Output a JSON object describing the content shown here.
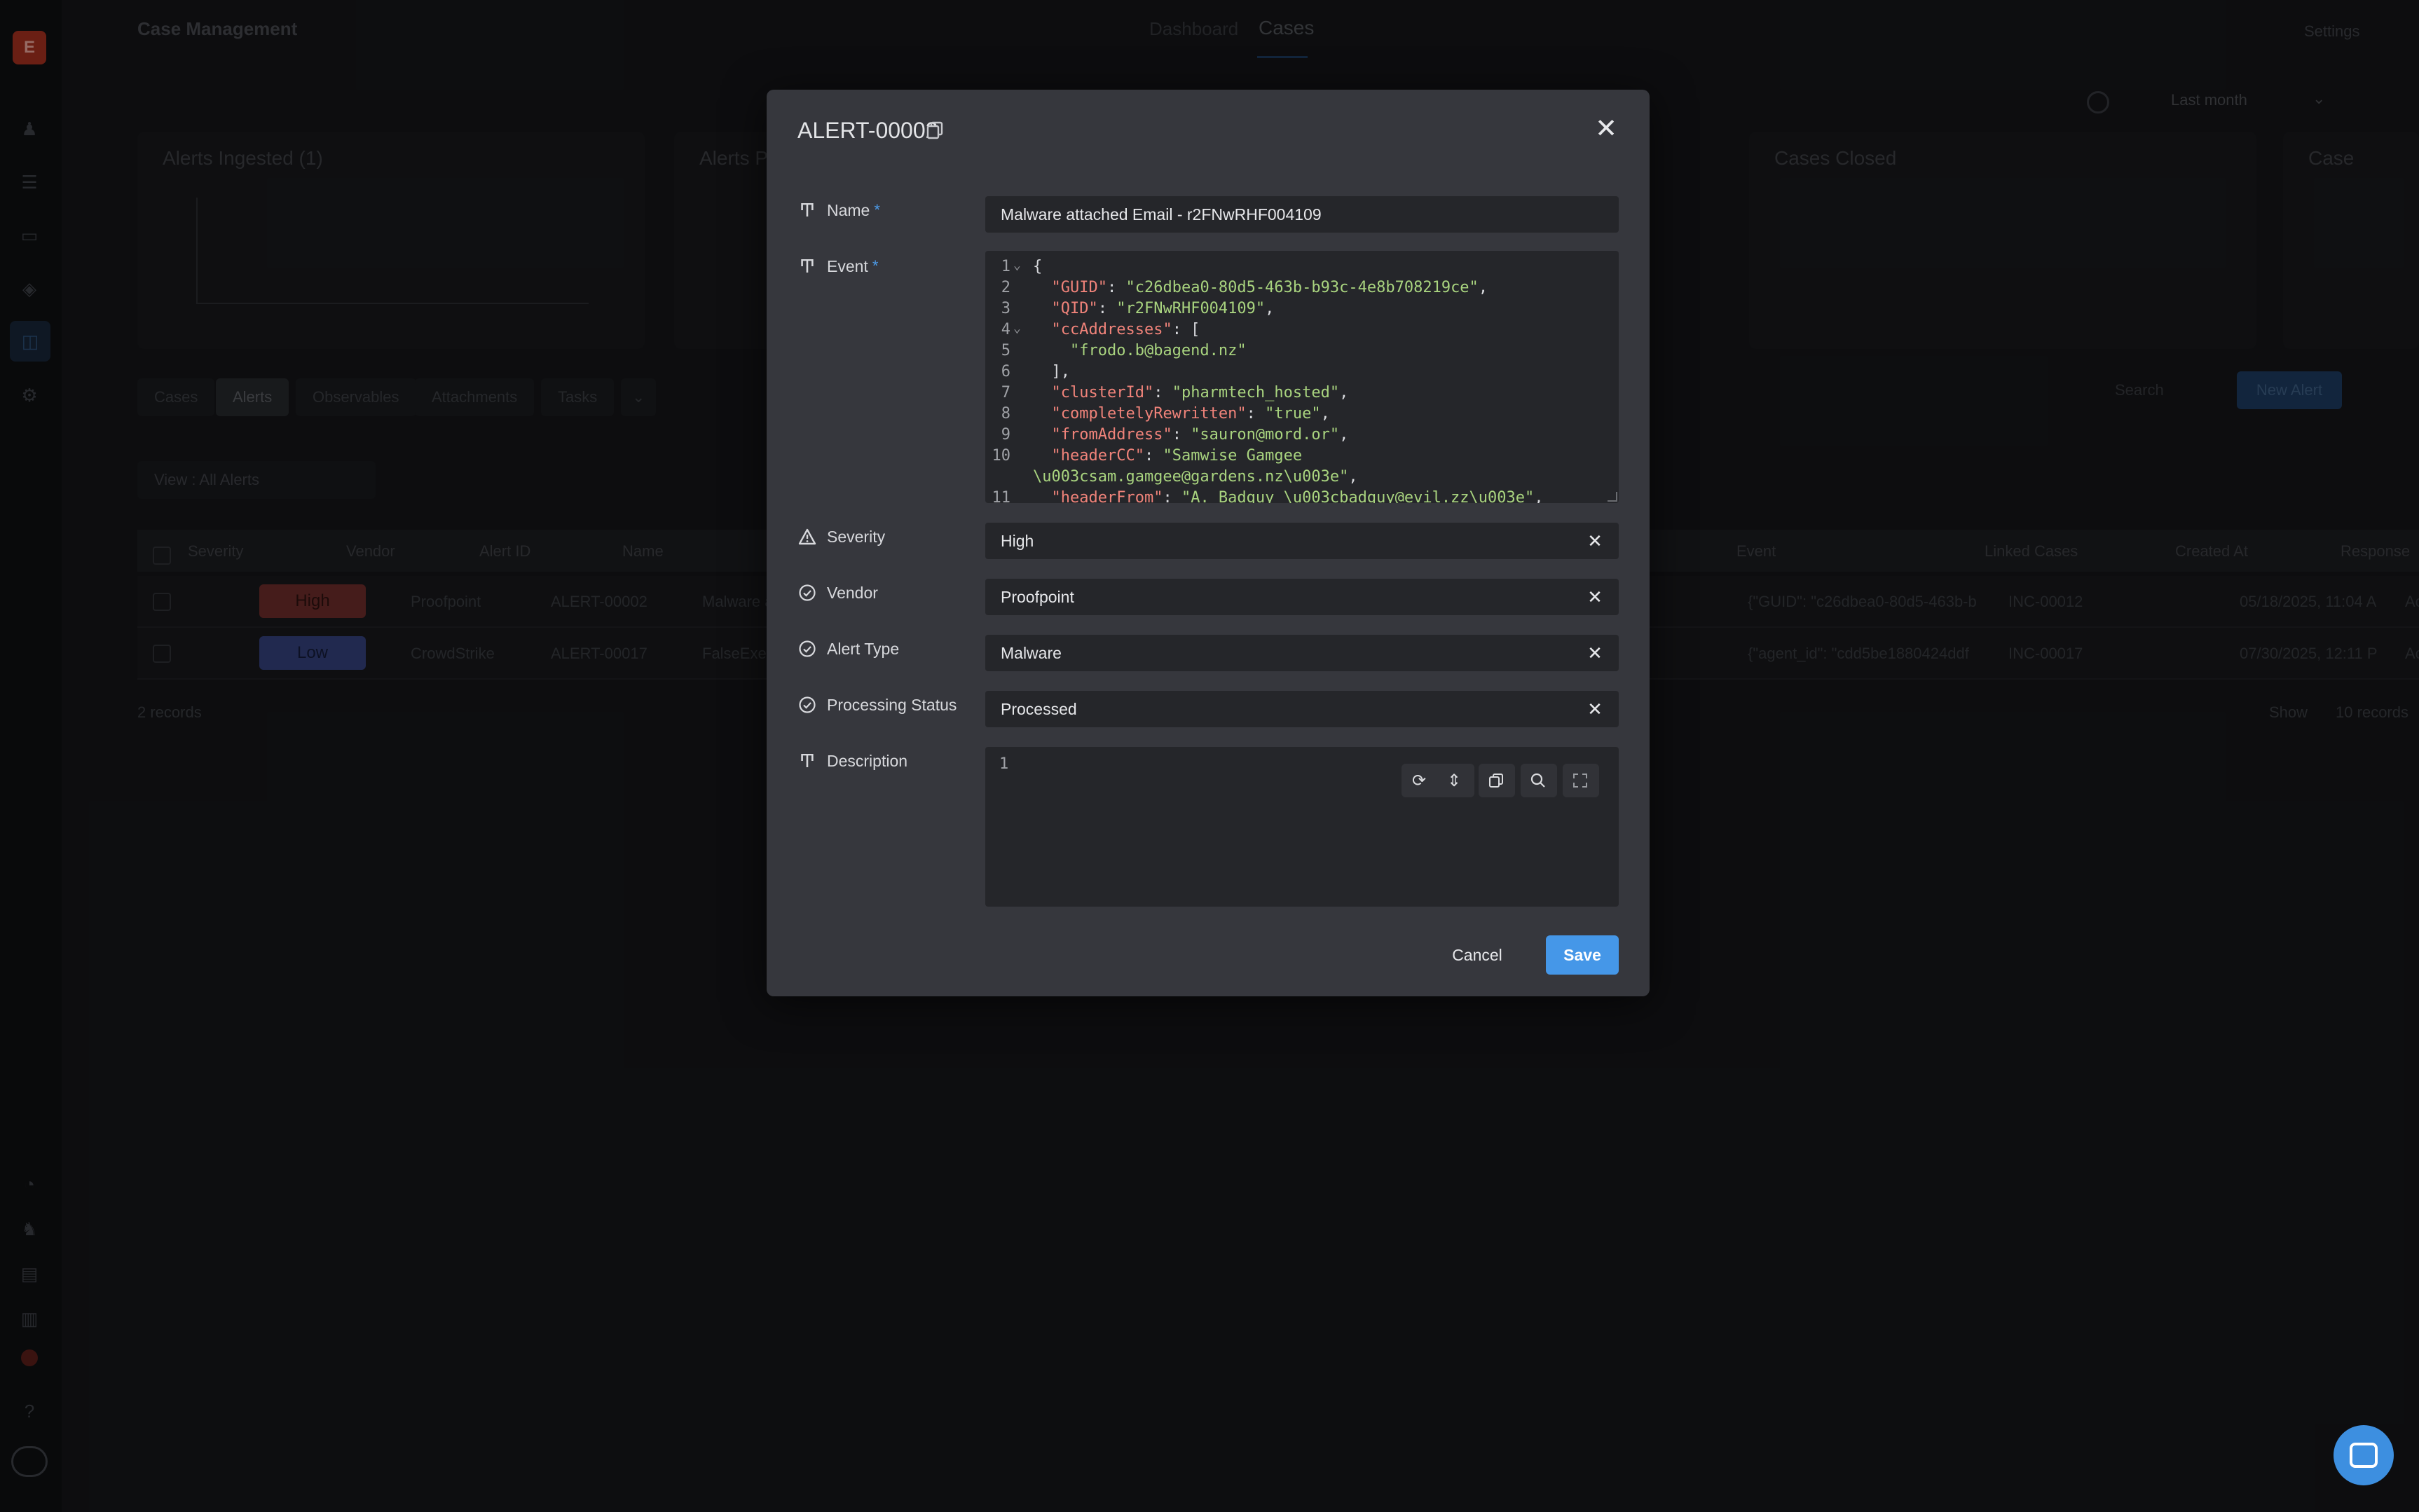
{
  "app": {
    "title": "Case Management",
    "nav": [
      "Dashboard",
      "Cases"
    ],
    "settings_label": "Settings",
    "date_range": "Last month",
    "logo_letter": "E"
  },
  "background": {
    "cards": [
      {
        "title": "Alerts Ingested  (1)"
      },
      {
        "title": "Alerts P"
      },
      {
        "title": "Cases Closed"
      },
      {
        "title": "Case"
      }
    ],
    "tabs": [
      "Cases",
      "Alerts",
      "Observables",
      "Attachments",
      "Tasks"
    ],
    "view_label": "View : All Alerts",
    "search_label": "Search",
    "new_alert_label": "New Alert",
    "columns": [
      "Severity",
      "Vendor",
      "Alert ID",
      "Name",
      "Event",
      "Linked Cases",
      "Created At",
      "Response"
    ],
    "rows": [
      {
        "severity": "High",
        "vendor": "Proofpoint",
        "alert_id": "ALERT-00002",
        "name": "Malware attached Em",
        "event": "{\"GUID\": \"c26dbea0-80d5-463b-b",
        "linked": "INC-00012",
        "created": "05/18/2025, 11:04 A",
        "response": "Action"
      },
      {
        "severity": "Low",
        "vendor": "CrowdStrike",
        "alert_id": "ALERT-00017",
        "name": "FalseExecutableExe",
        "event": "{\"agent_id\": \"cdd5be1880424ddf",
        "linked": "INC-00017",
        "created": "07/30/2025, 12:11 P",
        "response": "Action"
      }
    ],
    "records_label": "2 records",
    "show_label": "Show",
    "per_page": "10 records"
  },
  "modal": {
    "title": "ALERT-00002",
    "name_label": "Name",
    "name_value": "Malware attached Email - r2FNwRHF004109",
    "event_label": "Event",
    "event_lines": [
      {
        "n": "1",
        "fold": "⌄",
        "parts": [
          {
            "t": "{",
            "c": "p"
          }
        ]
      },
      {
        "n": "2",
        "fold": "",
        "parts": [
          {
            "t": "  ",
            "c": "p"
          },
          {
            "t": "\"GUID\"",
            "c": "k"
          },
          {
            "t": ": ",
            "c": "p"
          },
          {
            "t": "\"c26dbea0-80d5-463b-b93c-4e8b708219ce\"",
            "c": "s"
          },
          {
            "t": ",",
            "c": "p"
          }
        ]
      },
      {
        "n": "3",
        "fold": "",
        "parts": [
          {
            "t": "  ",
            "c": "p"
          },
          {
            "t": "\"QID\"",
            "c": "k"
          },
          {
            "t": ": ",
            "c": "p"
          },
          {
            "t": "\"r2FNwRHF004109\"",
            "c": "s"
          },
          {
            "t": ",",
            "c": "p"
          }
        ]
      },
      {
        "n": "4",
        "fold": "⌄",
        "parts": [
          {
            "t": "  ",
            "c": "p"
          },
          {
            "t": "\"ccAddresses\"",
            "c": "k"
          },
          {
            "t": ": [",
            "c": "p"
          }
        ]
      },
      {
        "n": "5",
        "fold": "",
        "parts": [
          {
            "t": "    ",
            "c": "p"
          },
          {
            "t": "\"frodo.b@bagend.nz\"",
            "c": "s"
          }
        ]
      },
      {
        "n": "6",
        "fold": "",
        "parts": [
          {
            "t": "  ],",
            "c": "p"
          }
        ]
      },
      {
        "n": "7",
        "fold": "",
        "parts": [
          {
            "t": "  ",
            "c": "p"
          },
          {
            "t": "\"clusterId\"",
            "c": "k"
          },
          {
            "t": ": ",
            "c": "p"
          },
          {
            "t": "\"pharmtech_hosted\"",
            "c": "s"
          },
          {
            "t": ",",
            "c": "p"
          }
        ]
      },
      {
        "n": "8",
        "fold": "",
        "parts": [
          {
            "t": "  ",
            "c": "p"
          },
          {
            "t": "\"completelyRewritten\"",
            "c": "k"
          },
          {
            "t": ": ",
            "c": "p"
          },
          {
            "t": "\"true\"",
            "c": "s"
          },
          {
            "t": ",",
            "c": "p"
          }
        ]
      },
      {
        "n": "9",
        "fold": "",
        "parts": [
          {
            "t": "  ",
            "c": "p"
          },
          {
            "t": "\"fromAddress\"",
            "c": "k"
          },
          {
            "t": ": ",
            "c": "p"
          },
          {
            "t": "\"sauron@mord.or\"",
            "c": "s"
          },
          {
            "t": ",",
            "c": "p"
          }
        ]
      },
      {
        "n": "10",
        "fold": "",
        "parts": [
          {
            "t": "  ",
            "c": "p"
          },
          {
            "t": "\"headerCC\"",
            "c": "k"
          },
          {
            "t": ": ",
            "c": "p"
          },
          {
            "t": "\"Samwise Gamgee",
            "c": "s"
          }
        ]
      },
      {
        "n": "",
        "fold": "",
        "parts": [
          {
            "t": "\\u003csam.gamgee@gardens.nz\\u003e\"",
            "c": "s"
          },
          {
            "t": ",",
            "c": "p"
          }
        ]
      },
      {
        "n": "11",
        "fold": "",
        "parts": [
          {
            "t": "  ",
            "c": "p"
          },
          {
            "t": "\"headerFrom\"",
            "c": "k"
          },
          {
            "t": ": ",
            "c": "p"
          },
          {
            "t": "\"A. Badguy \\u003cbadguy@evil.zz\\u003e\"",
            "c": "s"
          },
          {
            "t": ",",
            "c": "p"
          }
        ]
      }
    ],
    "severity_label": "Severity",
    "severity_value": "High",
    "vendor_label": "Vendor",
    "vendor_value": "Proofpoint",
    "alert_type_label": "Alert Type",
    "alert_type_value": "Malware",
    "processing_label": "Processing Status",
    "processing_value": "Processed",
    "description_label": "Description",
    "description_line": "1",
    "cancel_label": "Cancel",
    "save_label": "Save",
    "required_mark": "*",
    "close_glyph": "✕",
    "clear_glyph": "✕",
    "accent_color": "#4597e8"
  }
}
